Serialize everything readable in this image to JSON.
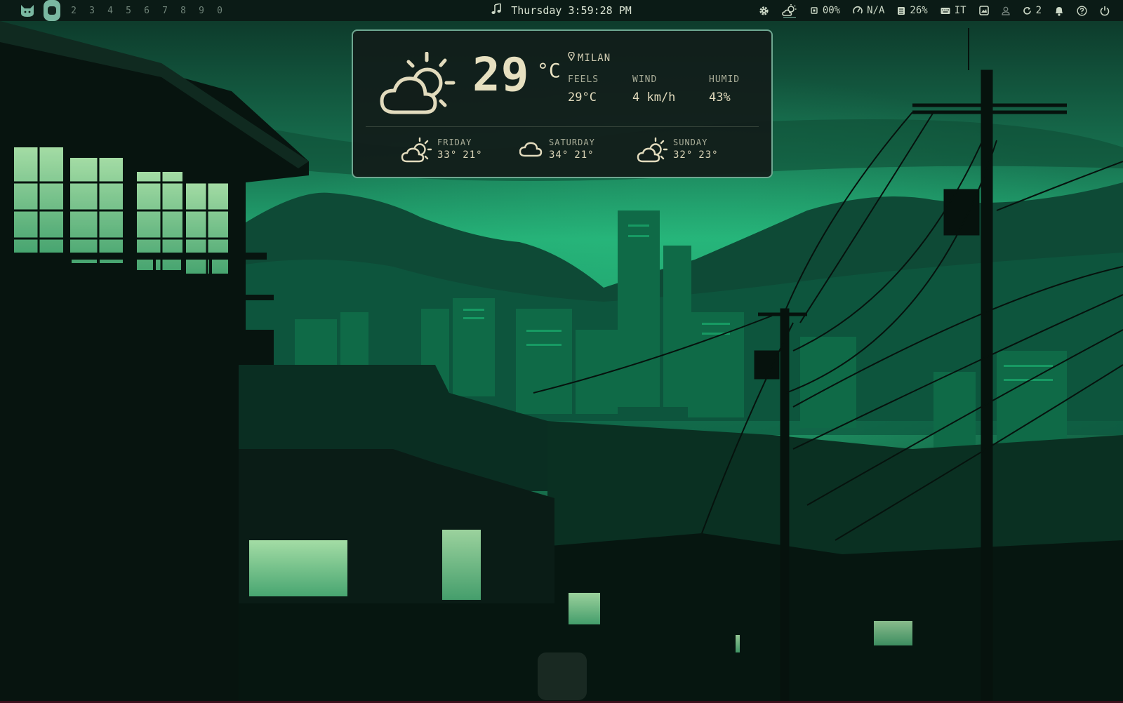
{
  "colors": {
    "accent": "#7ab8a1",
    "bar_bg": "#0c1a15",
    "widget_border": "#6fa791",
    "widget_text": "#e7e0c0"
  },
  "topbar": {
    "logo_icon": "cat-icon",
    "active_workspace_icon": "square-icon",
    "workspaces": [
      "2",
      "3",
      "4",
      "5",
      "6",
      "7",
      "8",
      "9",
      "0"
    ],
    "media_icon": "music-note-icon",
    "clock": "Thursday 3:59:28 PM",
    "tray": {
      "settings_icon": "gear-icon",
      "weather_icon": "partly-cloudy-icon",
      "cpu_icon": "cpu-icon",
      "cpu_value": "00%",
      "speed_icon": "gauge-icon",
      "speed_value": "N/A",
      "memory_icon": "memory-icon",
      "memory_value": "26%",
      "keyboard_icon": "keyboard-icon",
      "keyboard_layout": "IT",
      "screen_icon": "screenshot-icon",
      "user_icon": "user-icon",
      "updates_icon": "refresh-icon",
      "updates_count": "2",
      "notifications_icon": "bell-icon",
      "help_icon": "help-icon",
      "power_icon": "power-icon"
    }
  },
  "weather": {
    "icon": "partly-cloudy-icon",
    "temperature": "29",
    "unit": "°C",
    "location": "MILAN",
    "stats": [
      {
        "label": "FEELS",
        "value": "29°C"
      },
      {
        "label": "WIND",
        "value": "4 km/h"
      },
      {
        "label": "HUMID",
        "value": "43%"
      }
    ],
    "forecast": [
      {
        "day": "FRIDAY",
        "high": "33°",
        "low": "21°",
        "icon": "partly-cloudy-icon"
      },
      {
        "day": "SATURDAY",
        "high": "34°",
        "low": "21°",
        "icon": "cloud-icon"
      },
      {
        "day": "SUNDAY",
        "high": "32°",
        "low": "23°",
        "icon": "partly-cloudy-icon"
      }
    ]
  }
}
